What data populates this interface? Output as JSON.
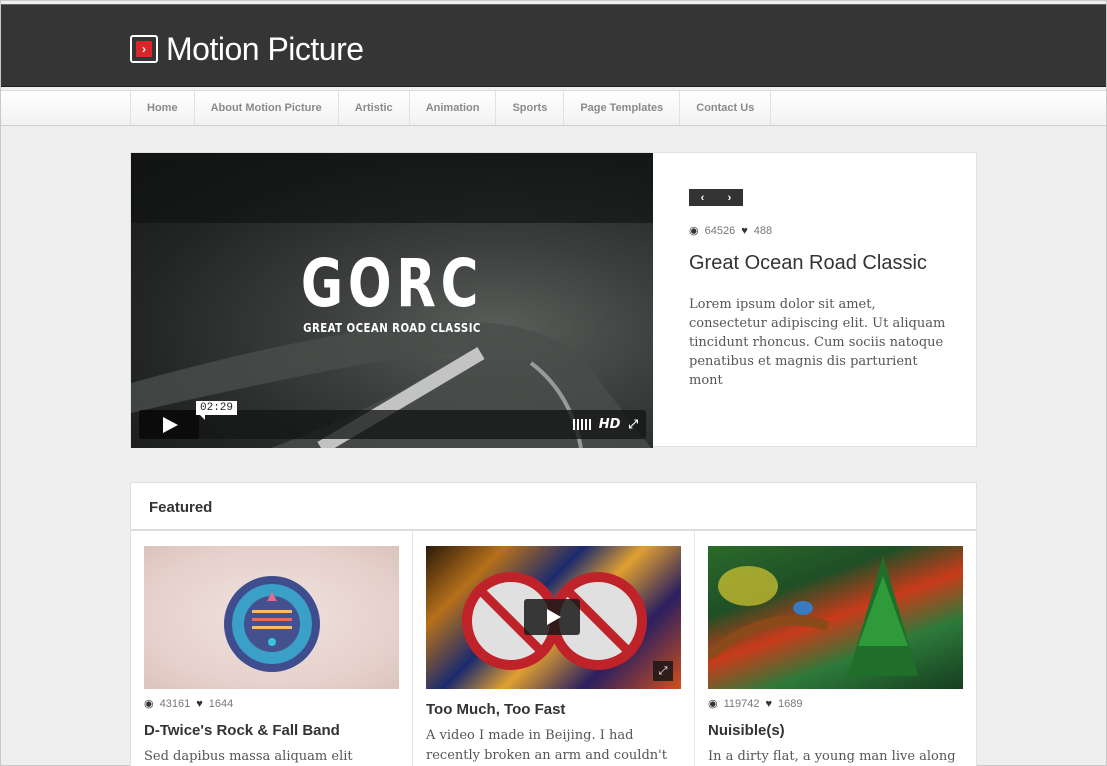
{
  "site": {
    "title": "Motion Picture",
    "logo_icon": "play-arrow-icon",
    "accent": "#d9262a"
  },
  "nav": {
    "items": [
      {
        "label": "Home"
      },
      {
        "label": "About Motion Picture"
      },
      {
        "label": "Artistic"
      },
      {
        "label": "Animation"
      },
      {
        "label": "Sports"
      },
      {
        "label": "Page Templates"
      },
      {
        "label": "Contact Us"
      }
    ]
  },
  "hero": {
    "video": {
      "title_text": "GORC",
      "subtitle_text": "GREAT OCEAN ROAD CLASSIC",
      "time": "02:29",
      "hd_label": "HD"
    },
    "pager": {
      "prev": "‹",
      "next": "›"
    },
    "views": "64526",
    "likes": "488",
    "title": "Great Ocean Road Classic",
    "description": "Lorem ipsum dolor sit amet, consectetur adipiscing elit. Ut aliquam tincidunt rhoncus. Cum sociis natoque penatibus et magnis dis parturient mont"
  },
  "featured": {
    "heading": "Featured",
    "items": [
      {
        "views": "43161",
        "likes": "1644",
        "title": "D-Twice's Rock & Fall Band",
        "description": "Sed dapibus massa aliquam elit"
      },
      {
        "views": "",
        "likes": "",
        "title": "Too Much, Too Fast",
        "description": "A video I made in Beijing. I had recently broken an arm and couldn't use full-size"
      },
      {
        "views": "119742",
        "likes": "1689",
        "title": "Nuisible(s)",
        "description": "In a dirty flat, a young man live along"
      }
    ]
  }
}
